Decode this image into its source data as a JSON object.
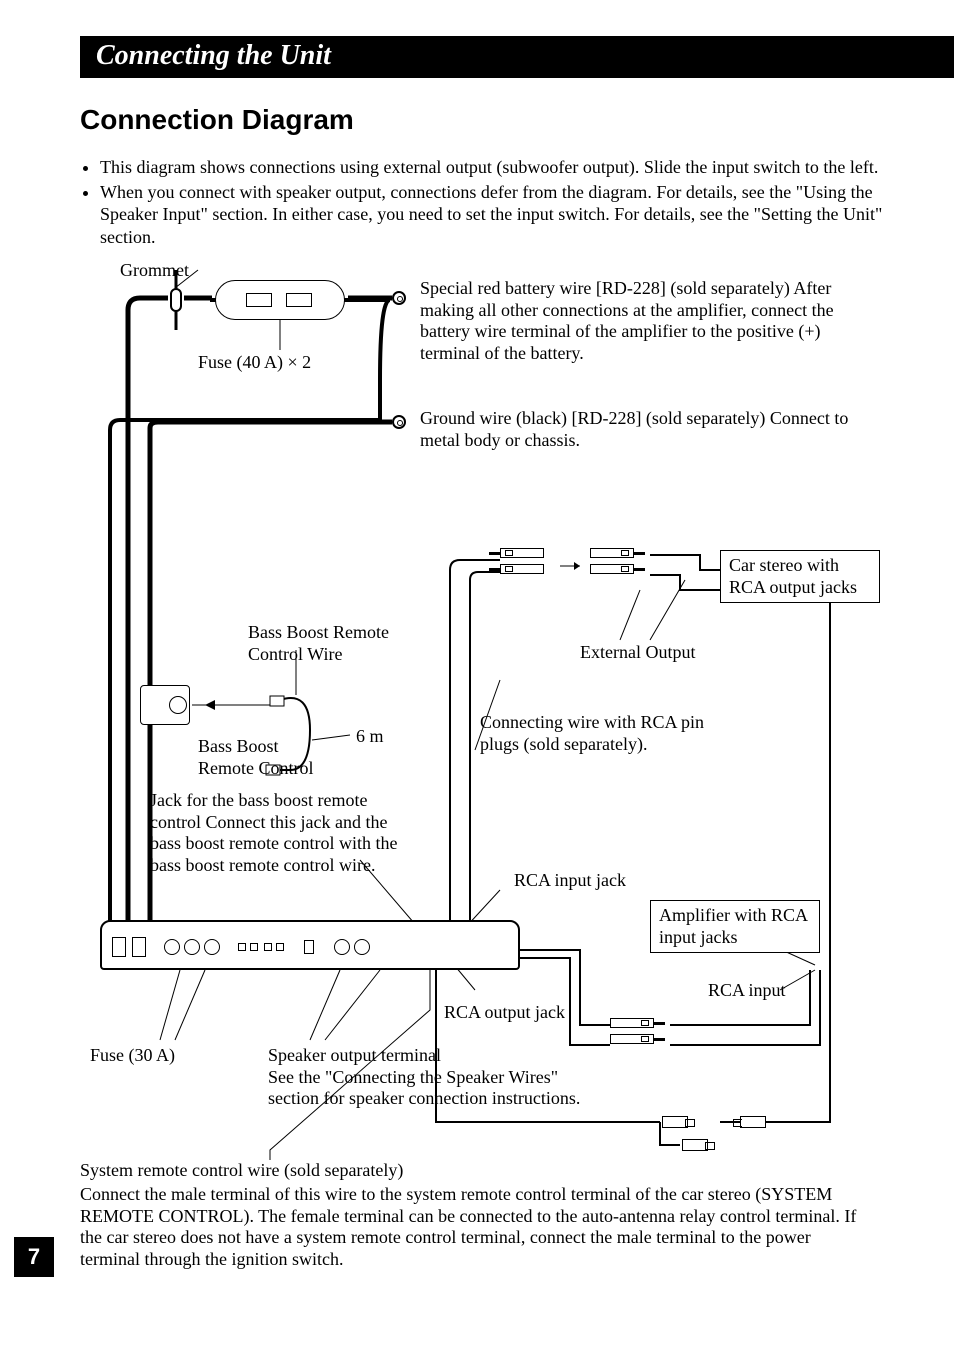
{
  "page": {
    "number": "7",
    "chapter_title": "Connecting the Unit",
    "section_title": "Connection Diagram"
  },
  "bullets": [
    "This diagram shows connections using external output (subwoofer output). Slide the input switch to the left.",
    "When you connect with speaker output, connections defer from the diagram. For details, see the \"Using the Speaker Input\" section. In either case, you need to set the input switch. For details, see the \"Setting the Unit\" section."
  ],
  "labels": {
    "grommet": "Grommet",
    "fuse_top": "Fuse (40 A) × 2",
    "battery_wire": "Special red battery wire [RD-228] (sold separately) After making all other connections at the amplifier, connect the battery wire terminal of the amplifier to the positive (+) terminal of the battery.",
    "ground_wire": "Ground wire (black) [RD-228] (sold separately) Connect to metal body or chassis.",
    "car_stereo_box": "Car stereo with RCA output jacks",
    "external_output": "External Output",
    "connecting_wire_rca": "Connecting wire with RCA pin plugs (sold separately).",
    "bass_boost_wire": "Bass Boost Remote Control Wire",
    "bass_boost_remote": "Bass Boost Remote Control",
    "six_m": "6 m",
    "jack_desc": "Jack for the bass boost remote control Connect this jack and the bass boost remote control with the bass boost remote control wire.",
    "rca_input_jack": "RCA input jack",
    "amp_rca_box": "Amplifier with RCA input jacks",
    "rca_input": "RCA input",
    "rca_output_jack": "RCA output jack",
    "fuse_30": "Fuse (30 A)",
    "speaker_output": "Speaker output terminal\nSee the \"Connecting the Speaker Wires\" section for speaker connection instructions.",
    "system_remote_title": "System remote control wire (sold separately)",
    "system_remote_body": "Connect the male terminal of this wire to the system remote control terminal of the car stereo (SYSTEM REMOTE CONTROL). The female terminal can be connected to the auto-antenna relay control terminal. If the car stereo does not have a system remote control terminal, connect the male terminal to the power terminal through the ignition switch."
  }
}
